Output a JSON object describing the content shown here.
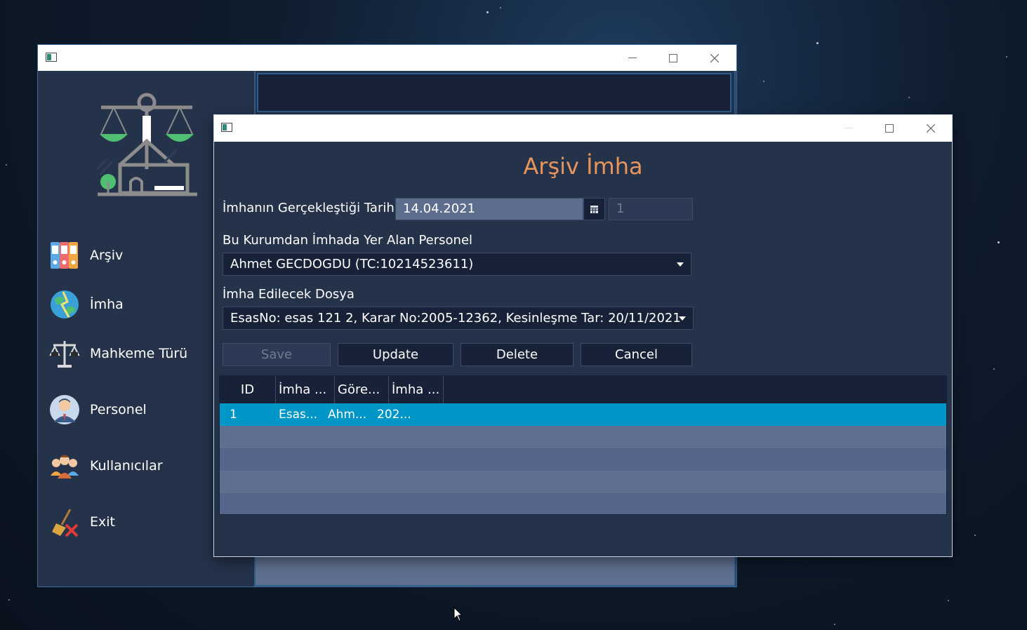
{
  "main_window": {
    "sidebar": {
      "items": [
        {
          "label": "Arşiv",
          "icon": "archive-binders-icon"
        },
        {
          "label": "İmha",
          "icon": "globe-destroy-icon"
        },
        {
          "label": "Mahkeme Türü",
          "icon": "scales-icon"
        },
        {
          "label": "Personel",
          "icon": "person-avatar-icon"
        },
        {
          "label": "Kullanıcılar",
          "icon": "users-group-icon"
        },
        {
          "label": "Exit",
          "icon": "exit-broom-icon"
        }
      ]
    }
  },
  "dialog": {
    "title": "Arşiv İmha",
    "date_label": "İmhanın Gerçekleştiği Tarih",
    "date_value": "14.04.2021",
    "id_value": "1",
    "personnel_label": "Bu Kurumdan İmhada Yer Alan Personel",
    "personnel_value": "Ahmet GECDOGDU (TC:10214523611)",
    "file_label": "İmha Edilecek Dosya",
    "file_value": "EsasNo: esas 121 2, Karar No:2005-12362, Kesinleşme Tar: 20/11/2021",
    "buttons": {
      "save": "Save",
      "update": "Update",
      "delete": "Delete",
      "cancel": "Cancel"
    },
    "table": {
      "columns": [
        "ID",
        "İmha ...",
        "Göre...",
        "İmha ..."
      ],
      "rows": [
        {
          "id": "1",
          "c1": "Esas...",
          "c2": "Ahm...",
          "c3": "202..."
        }
      ]
    }
  },
  "colors": {
    "accent_title": "#e8955c",
    "selected_row": "#0097c8",
    "panel_dark": "#172238",
    "window_bg": "#24324a"
  }
}
